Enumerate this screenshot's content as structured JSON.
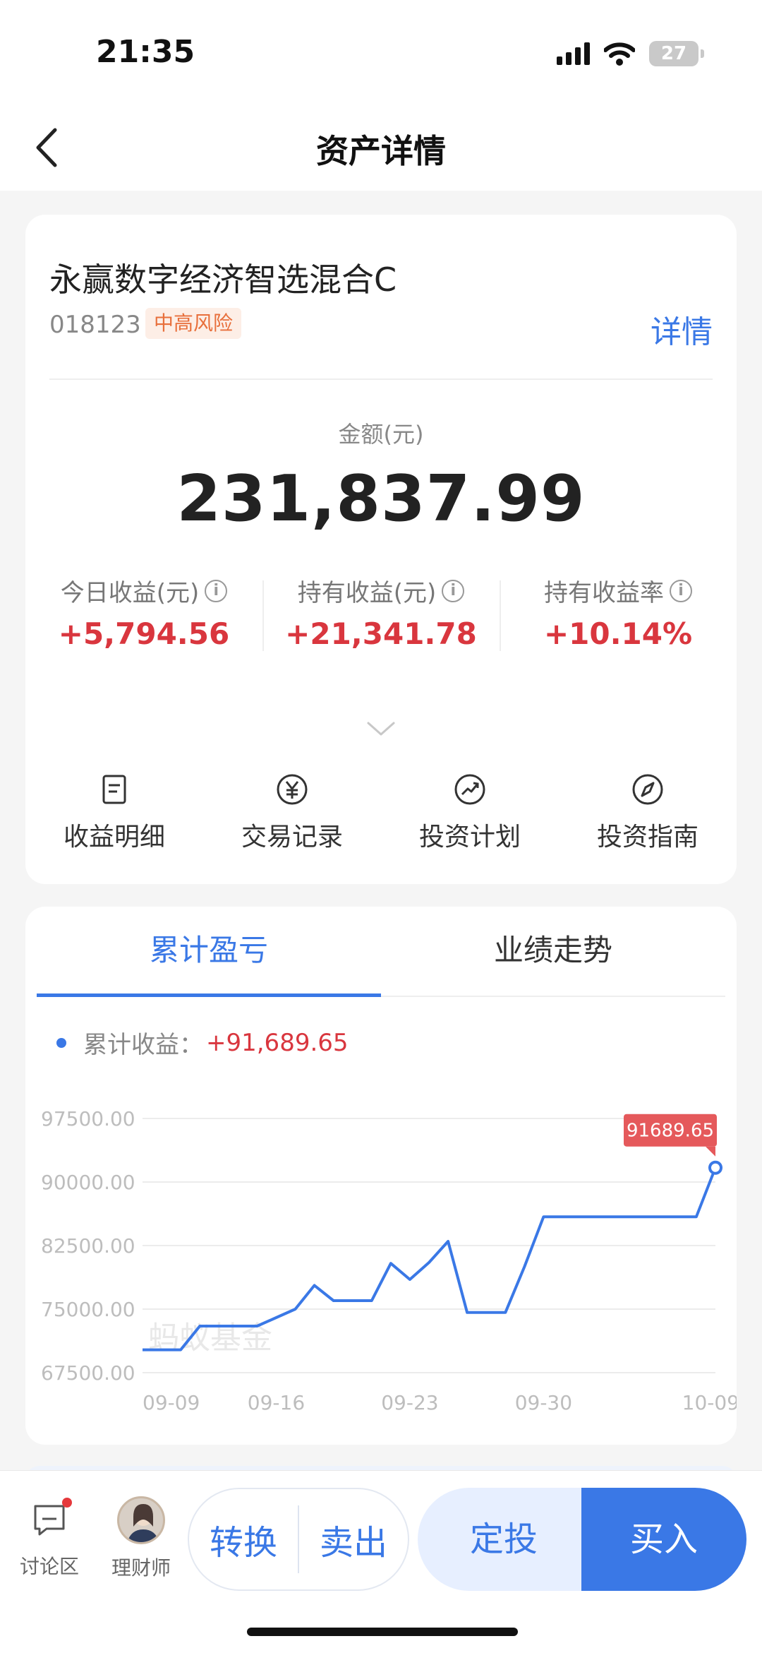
{
  "status_bar": {
    "time": "21:35",
    "battery": "27"
  },
  "header": {
    "title": "资产详情"
  },
  "fund": {
    "name": "永赢数字经济智选混合C",
    "code": "018123",
    "risk": "中高风险",
    "detail_label": "详情"
  },
  "amount": {
    "label": "金额(元)",
    "value": "231,837.99"
  },
  "stats": [
    {
      "label": "今日收益(元)",
      "value": "+5,794.56"
    },
    {
      "label": "持有收益(元)",
      "value": "+21,341.78"
    },
    {
      "label": "持有收益率",
      "value": "+10.14%"
    }
  ],
  "actions": [
    {
      "label": "收益明细",
      "icon": "document-icon"
    },
    {
      "label": "交易记录",
      "icon": "yuan-icon"
    },
    {
      "label": "投资计划",
      "icon": "trend-icon"
    },
    {
      "label": "投资指南",
      "icon": "compass-icon"
    }
  ],
  "chart_tabs": [
    {
      "label": "累计盈亏",
      "active": true
    },
    {
      "label": "业绩走势",
      "active": false
    }
  ],
  "legend": {
    "label": "累计收益：",
    "value": "+91,689.65"
  },
  "chart_data": {
    "type": "line",
    "watermark": "蚂蚁基金",
    "x_ticks": [
      "09-09",
      "09-16",
      "09-23",
      "09-30",
      "10-09"
    ],
    "y_ticks": [
      "97500.00",
      "90000.00",
      "82500.00",
      "75000.00",
      "67500.00"
    ],
    "ylim": [
      67500,
      97500
    ],
    "x": [
      "09-09",
      "09-10",
      "09-11",
      "09-12",
      "09-13",
      "09-14",
      "09-15",
      "09-16",
      "09-17",
      "09-18",
      "09-19",
      "09-20",
      "09-21",
      "09-22",
      "09-23",
      "09-24",
      "09-25",
      "09-26",
      "09-27",
      "09-28",
      "09-29",
      "09-30",
      "10-01",
      "10-02",
      "10-03",
      "10-04",
      "10-05",
      "10-06",
      "10-07",
      "10-08",
      "10-09"
    ],
    "series": [
      {
        "color": "#3a78e6",
        "values": [
          70200,
          70200,
          70200,
          73000,
          73000,
          73000,
          73000,
          74000,
          75000,
          77800,
          76000,
          76000,
          76000,
          80400,
          78500,
          80500,
          83000,
          74600,
          74600,
          74600,
          80000,
          85900,
          85900,
          85900,
          85900,
          85900,
          85900,
          85900,
          85900,
          85900,
          91689.65
        ]
      }
    ],
    "last_label": "91689.65"
  },
  "bottom_bar": {
    "discuss": "讨论区",
    "advisor": "理财师",
    "convert": "转换",
    "sell": "卖出",
    "invest": "定投",
    "buy": "买入"
  }
}
